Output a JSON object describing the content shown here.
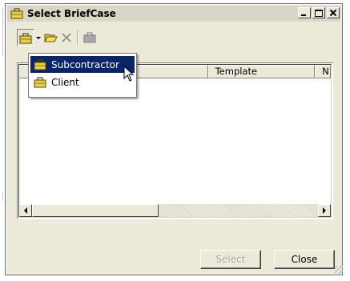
{
  "window": {
    "title": "Select BriefCase"
  },
  "toolbar": {
    "icons": [
      "new-briefcase-icon",
      "dropdown-arrow-icon",
      "open-folder-icon",
      "delete-icon",
      "briefcase-icon"
    ]
  },
  "dropdown_menu": {
    "items": [
      {
        "label": "Subcontractor",
        "icon": "briefcase-icon",
        "highlighted": true
      },
      {
        "label": "Client",
        "icon": "briefcase-icon",
        "highlighted": false
      }
    ]
  },
  "list": {
    "columns": [
      "",
      "Template",
      "N"
    ],
    "rows": []
  },
  "buttons": {
    "select": {
      "label": "Select",
      "enabled": false
    },
    "close": {
      "label": "Close",
      "enabled": true
    }
  },
  "colors": {
    "highlight": "#0a246a",
    "window_bg": "#ece9d8",
    "briefcase": "#e8d24a"
  }
}
